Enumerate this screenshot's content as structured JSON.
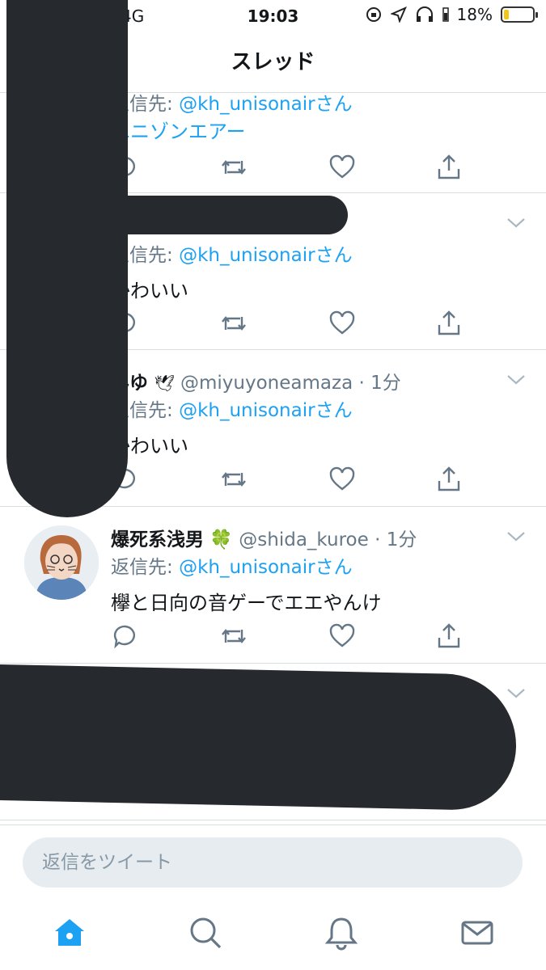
{
  "status_bar": {
    "carrier": "4G",
    "time": "19:03",
    "battery": "18%",
    "battery_level": 0.18
  },
  "nav": {
    "title": "スレッド"
  },
  "tweets": [
    {
      "reply_label": "返信先: ",
      "reply_mention": "@kh_unisonairさん",
      "text": "ユニゾンエアー"
    },
    {
      "reply_label": "返信先: ",
      "reply_mention": "@kh_unisonairさん",
      "text": "かわいい"
    },
    {
      "name": "みゆ",
      "handle": "@miyuyoneamaza",
      "time": "1分",
      "reply_label": "返信先: ",
      "reply_mention": "@kh_unisonairさん",
      "text": "かわいい"
    },
    {
      "name": "爆死系浅男",
      "name_emoji": "🍀",
      "handle": "@shida_kuroe",
      "time": "1分",
      "reply_label": "返信先: ",
      "reply_mention": "@kh_unisonairさん",
      "text": "欅と日向の音ゲーでエエやんけ"
    }
  ],
  "reply_box": {
    "placeholder": "返信をツイート"
  },
  "tabbar": {
    "items": [
      "home-icon",
      "search-icon",
      "bell-icon",
      "mail-icon"
    ],
    "active": "home-icon"
  },
  "colors": {
    "accent": "#1da1f2",
    "icon": "#657786",
    "redaction": "#26292d"
  }
}
